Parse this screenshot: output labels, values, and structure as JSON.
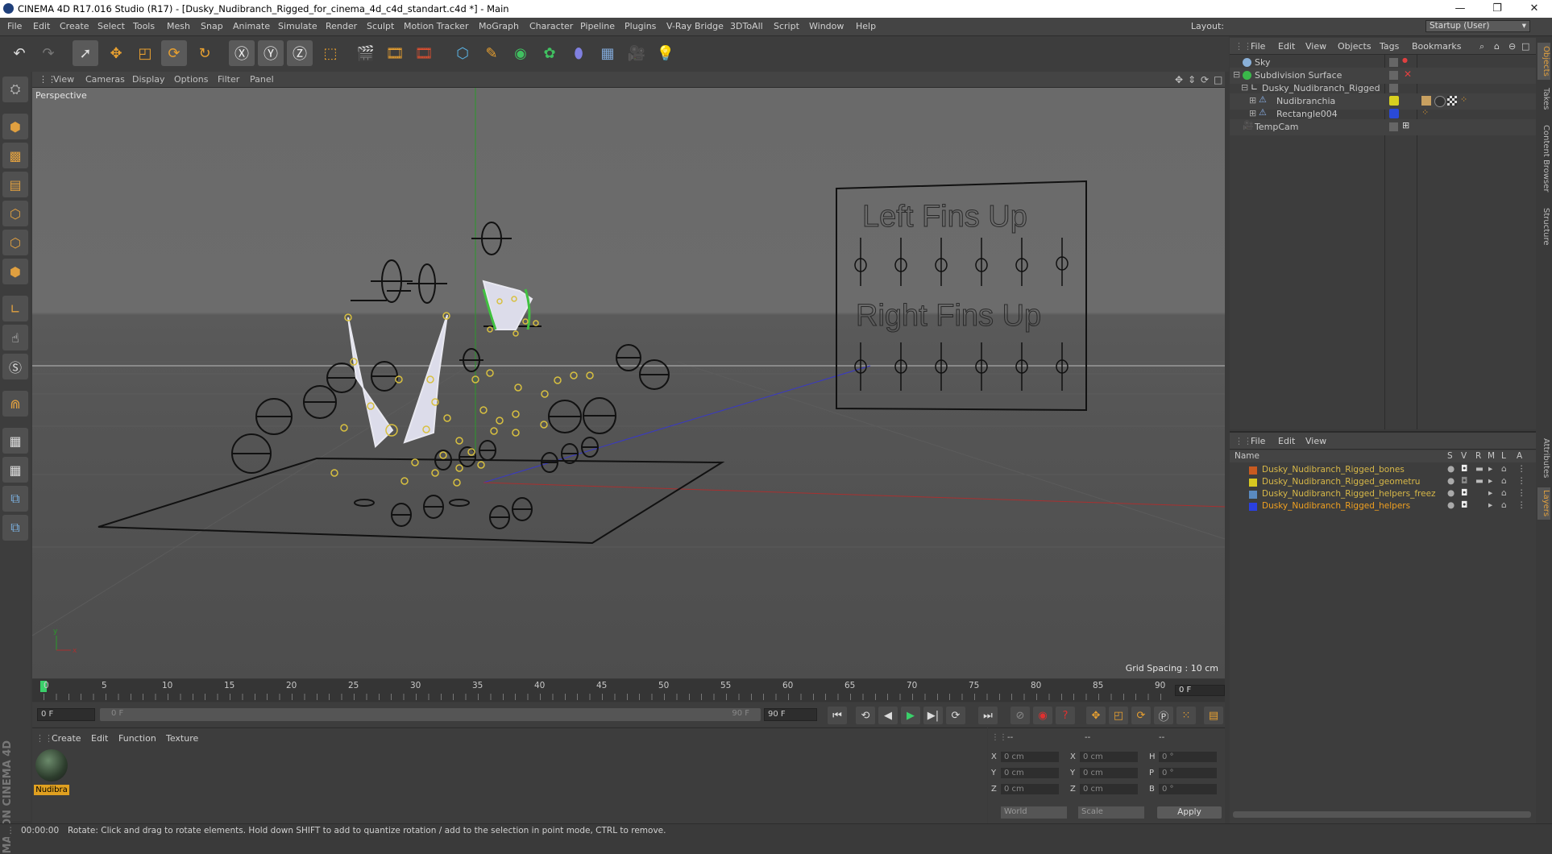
{
  "window": {
    "title": "CINEMA 4D R17.016 Studio (R17) - [Dusky_Nudibranch_Rigged_for_cinema_4d_c4d_standart.c4d *] - Main",
    "minimize": "—",
    "maximize": "❐",
    "close": "✕"
  },
  "menu": [
    "File",
    "Edit",
    "Create",
    "Select",
    "Tools",
    "Mesh",
    "Snap",
    "Animate",
    "Simulate",
    "Render",
    "Sculpt",
    "Motion Tracker",
    "MoGraph",
    "Character",
    "Pipeline",
    "Plugins",
    "V-Ray Bridge",
    "3DToAll",
    "Script",
    "Window",
    "Help"
  ],
  "layout": {
    "label": "Layout:",
    "value": "Startup (User)"
  },
  "toolbar_icons": [
    "undo-icon",
    "redo-icon",
    "select-arrow-icon",
    "move-icon",
    "scale-icon",
    "rotate-icon",
    "recent-tool-icon",
    "x-axis-icon",
    "y-axis-icon",
    "z-axis-icon",
    "world-coord-icon",
    "render-view-icon",
    "render-picture-queue-icon",
    "render-settings-icon",
    "cube-icon",
    "pen-spline-icon",
    "subdivision-icon",
    "cloner-icon",
    "deformer-icon",
    "floor-icon",
    "camera-icon",
    "light-icon"
  ],
  "viewport": {
    "menu": [
      "View",
      "Cameras",
      "Display",
      "Options",
      "Filter",
      "Panel"
    ],
    "label": "Perspective",
    "grid_spacing": "Grid Spacing : 10 cm",
    "board_text_1": "Left Fins Up",
    "board_text_2": "Right Fins Up"
  },
  "timeline": {
    "ticks": [
      "0",
      "5",
      "10",
      "15",
      "20",
      "25",
      "30",
      "35",
      "40",
      "45",
      "50",
      "55",
      "60",
      "65",
      "70",
      "75",
      "80",
      "85",
      "90"
    ],
    "end_field": "0 F"
  },
  "playback": {
    "start_field": "0 F",
    "range_start": "0 F",
    "range_end": "90 F",
    "end_field": "90 F"
  },
  "material_manager": {
    "menu": [
      "Create",
      "Edit",
      "Function",
      "Texture"
    ],
    "material_name": "Nudibra"
  },
  "coordinates": {
    "header": [
      "--",
      "--",
      "--"
    ],
    "rows": [
      {
        "l1": "X",
        "v1": "0 cm",
        "l2": "X",
        "v2": "0 cm",
        "l3": "H",
        "v3": "0 °"
      },
      {
        "l1": "Y",
        "v1": "0 cm",
        "l2": "Y",
        "v2": "0 cm",
        "l3": "P",
        "v3": "0 °"
      },
      {
        "l1": "Z",
        "v1": "0 cm",
        "l2": "Z",
        "v2": "0 cm",
        "l3": "B",
        "v3": "0 °"
      }
    ],
    "mode1": "World",
    "mode2": "Scale",
    "apply": "Apply"
  },
  "object_manager": {
    "menu": [
      "File",
      "Edit",
      "View",
      "Objects",
      "Tags",
      "Bookmarks"
    ],
    "objects": [
      {
        "name": "Sky",
        "indent": 0,
        "color": ""
      },
      {
        "name": "Subdivision Surface",
        "indent": 0,
        "color": ""
      },
      {
        "name": "Dusky_Nudibranch_Rigged",
        "indent": 1,
        "color": ""
      },
      {
        "name": "Nudibranchia",
        "indent": 2,
        "color": "#d8d020"
      },
      {
        "name": "Rectangle004",
        "indent": 2,
        "color": "#2a4ad8"
      },
      {
        "name": "TempCam",
        "indent": 0,
        "color": ""
      }
    ]
  },
  "layer_manager": {
    "menu": [
      "File",
      "Edit",
      "View"
    ],
    "columns": [
      "Name",
      "S",
      "V",
      "R",
      "M",
      "L",
      "A"
    ],
    "layers": [
      {
        "name": "Dusky_Nudibranch_Rigged_bones",
        "color": "#c85a20",
        "highlight": false
      },
      {
        "name": "Dusky_Nudibranch_Rigged_geometru",
        "color": "#d8c820",
        "highlight": false
      },
      {
        "name": "Dusky_Nudibranch_Rigged_helpers_freez",
        "color": "#5a8ac0",
        "highlight": false
      },
      {
        "name": "Dusky_Nudibranch_Rigged_helpers",
        "color": "#2a40e0",
        "highlight": true
      }
    ]
  },
  "side_tabs": [
    "Objects",
    "Takes",
    "Content Browser",
    "Structure",
    "Attributes",
    "Layers"
  ],
  "status": {
    "time": "00:00:00",
    "message": "Rotate: Click and drag to rotate elements. Hold down SHIFT to add to quantize rotation / add to the selection in point mode, CTRL to remove."
  },
  "brand": "MAXON CINEMA 4D"
}
